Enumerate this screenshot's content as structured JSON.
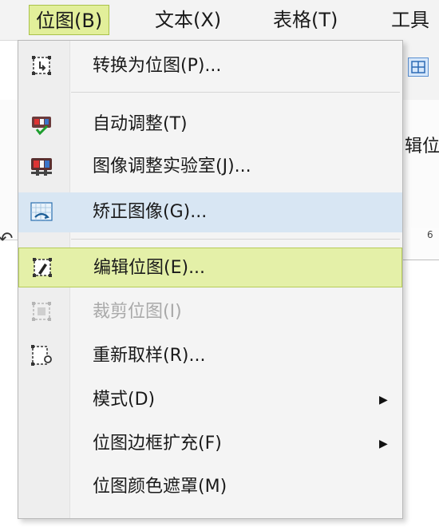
{
  "menubar": {
    "items": [
      {
        "label": "位图(B)",
        "active": true
      },
      {
        "label": "文本(X)",
        "active": false
      },
      {
        "label": "表格(T)",
        "active": false
      },
      {
        "label": "工具",
        "active": false
      }
    ]
  },
  "background": {
    "property_text": "辑位",
    "ruler_number": "6",
    "undo_glyph": "↶"
  },
  "bitmap_menu": {
    "items": [
      {
        "label": "转换为位图(P)...",
        "icon": "convert-to-bitmap-icon",
        "state": "normal"
      },
      {
        "label": "自动调整(T)",
        "icon": "auto-adjust-icon",
        "state": "normal"
      },
      {
        "label": "图像调整实验室(J)...",
        "icon": "image-adjustment-lab-icon",
        "state": "normal"
      },
      {
        "label": "矫正图像(G)...",
        "icon": "straighten-image-icon",
        "state": "hover"
      },
      {
        "label": "编辑位图(E)...",
        "icon": "edit-bitmap-icon",
        "state": "highlighted"
      },
      {
        "label": "裁剪位图(I)",
        "icon": "crop-bitmap-icon",
        "state": "disabled"
      },
      {
        "label": "重新取样(R)...",
        "icon": "resample-icon",
        "state": "normal"
      },
      {
        "label": "模式(D)",
        "icon": null,
        "state": "normal",
        "submenu": true
      },
      {
        "label": "位图边框扩充(F)",
        "icon": null,
        "state": "normal",
        "submenu": true
      },
      {
        "label": "位图颜色遮罩(M)",
        "icon": null,
        "state": "normal"
      }
    ]
  },
  "colors": {
    "active_menu_bg": "#e2ef9a",
    "hover_blue": "#d8e6f3",
    "highlight_green": "#e4f0a8",
    "disabled_text": "#a9a9a9"
  }
}
